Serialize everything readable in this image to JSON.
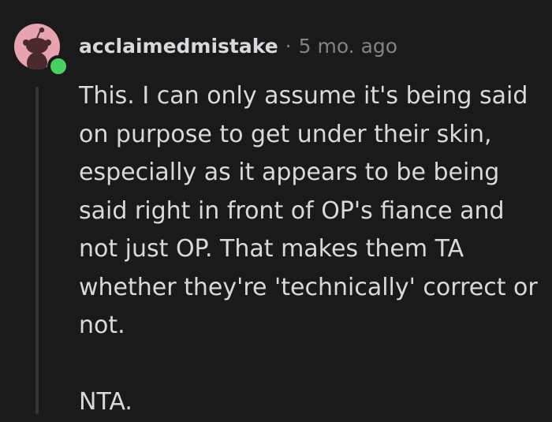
{
  "comment": {
    "username": "acclaimedmistake",
    "separator": "·",
    "timestamp": "5 mo. ago",
    "avatar_icon": "snoo-avatar-icon",
    "online_indicator_color": "#46d160",
    "paragraphs": [
      "This. I can only assume it's being said on purpose to get under their skin, especially as it appears to be being said right in front of OP's fiance and not just OP. That makes them TA whether they're 'technically' correct or not.",
      "NTA."
    ]
  },
  "colors": {
    "background": "#1a1a1b",
    "text": "#d7dadc",
    "muted": "#818384",
    "avatar_bg": "#e8a3b0",
    "thread_line": "#343536"
  }
}
